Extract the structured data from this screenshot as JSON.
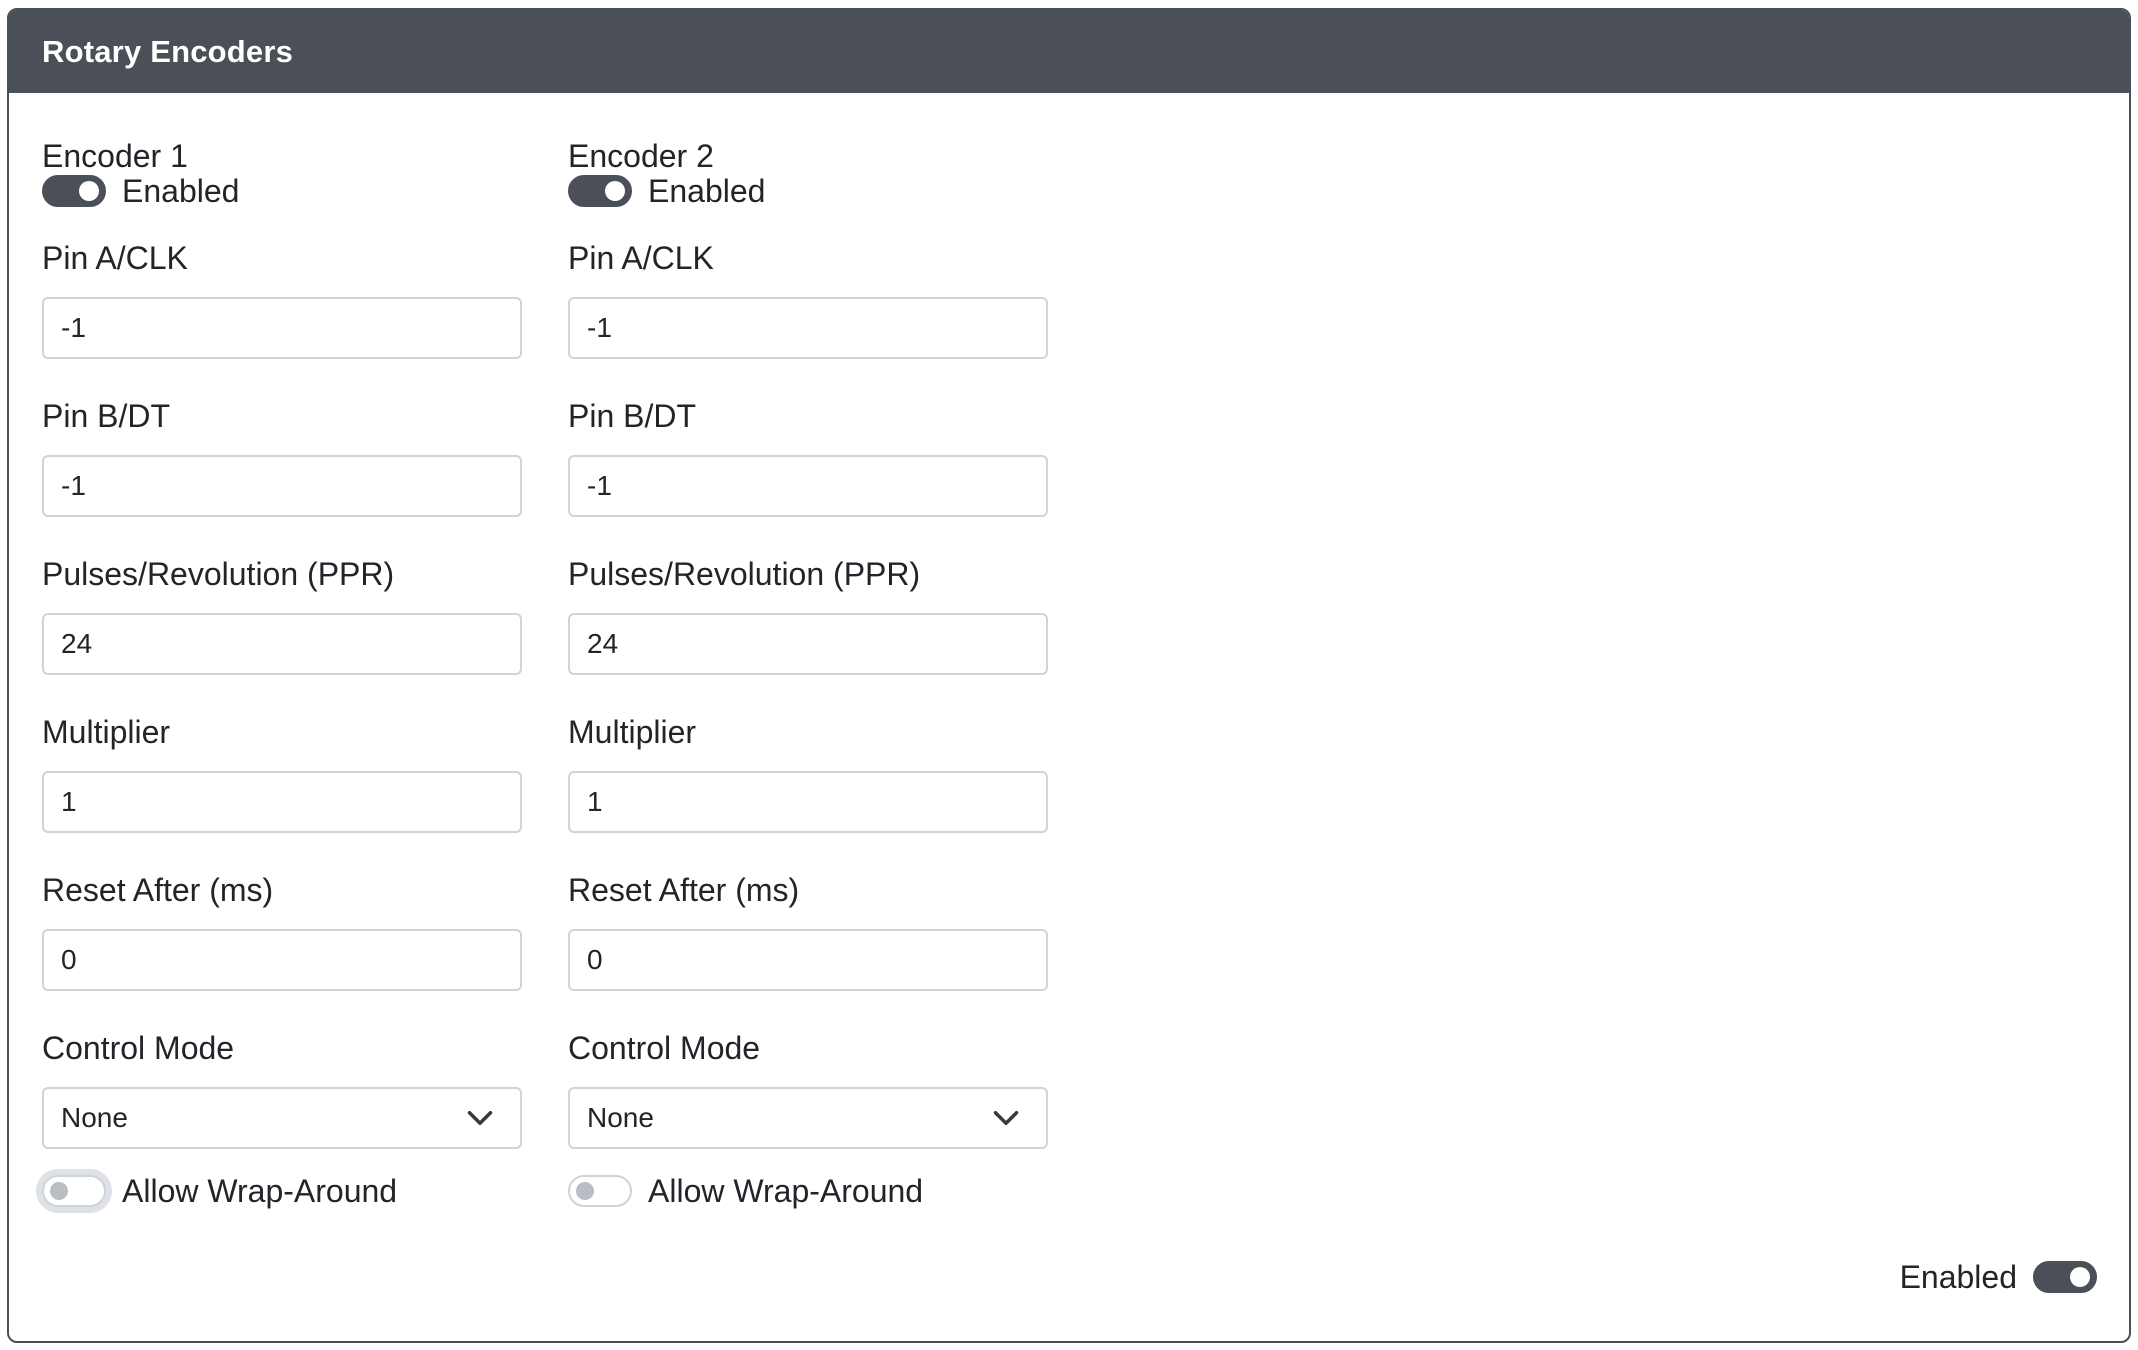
{
  "card": {
    "title": "Rotary Encoders",
    "footer_toggle_label": "Enabled",
    "footer_toggle_on": true
  },
  "encoders": [
    {
      "title": "Encoder 1",
      "enabled_label": "Enabled",
      "enabled": true,
      "pin_a_label": "Pin A/CLK",
      "pin_a_value": "-1",
      "pin_b_label": "Pin B/DT",
      "pin_b_value": "-1",
      "ppr_label": "Pulses/Revolution (PPR)",
      "ppr_value": "24",
      "multiplier_label": "Multiplier",
      "multiplier_value": "1",
      "reset_label": "Reset After (ms)",
      "reset_value": "0",
      "mode_label": "Control Mode",
      "mode_value": "None",
      "wrap_label": "Allow Wrap-Around",
      "wrap_enabled": false
    },
    {
      "title": "Encoder 2",
      "enabled_label": "Enabled",
      "enabled": true,
      "pin_a_label": "Pin A/CLK",
      "pin_a_value": "-1",
      "pin_b_label": "Pin B/DT",
      "pin_b_value": "-1",
      "ppr_label": "Pulses/Revolution (PPR)",
      "ppr_value": "24",
      "multiplier_label": "Multiplier",
      "multiplier_value": "1",
      "reset_label": "Reset After (ms)",
      "reset_value": "0",
      "mode_label": "Control Mode",
      "mode_value": "None",
      "wrap_label": "Allow Wrap-Around",
      "wrap_enabled": false
    }
  ],
  "colors": {
    "header_bg": "#4b5058",
    "switch_on": "#4b5058",
    "input_border": "#ced4da"
  }
}
